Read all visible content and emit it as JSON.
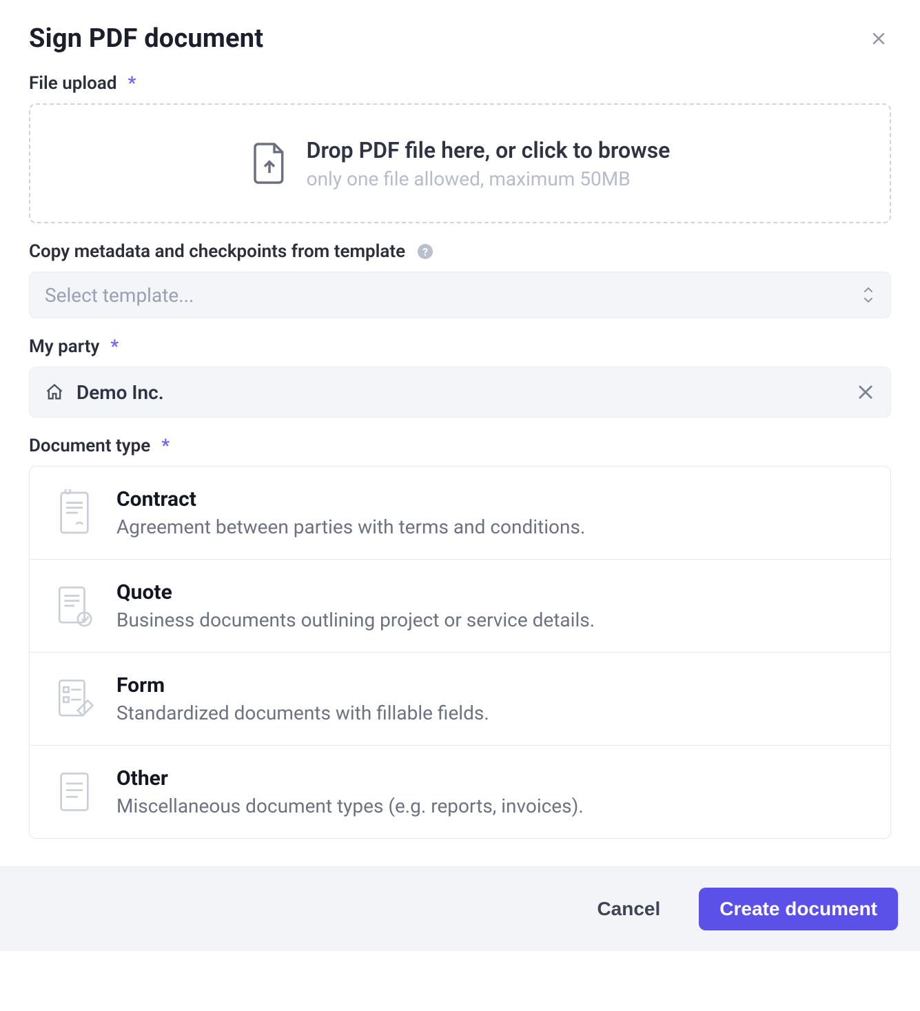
{
  "header": {
    "title": "Sign PDF document"
  },
  "sections": {
    "file_upload": {
      "label": "File upload",
      "dropzone": {
        "title": "Drop PDF file here, or click to browse",
        "subtitle": "only one file allowed, maximum 50MB"
      }
    },
    "template": {
      "label": "Copy metadata and checkpoints from template",
      "placeholder": "Select template..."
    },
    "my_party": {
      "label": "My party",
      "value": "Demo Inc."
    },
    "doc_type": {
      "label": "Document type",
      "options": [
        {
          "title": "Contract",
          "desc": "Agreement between parties with terms and conditions."
        },
        {
          "title": "Quote",
          "desc": "Business documents outlining project or service details."
        },
        {
          "title": "Form",
          "desc": "Standardized documents with fillable fields."
        },
        {
          "title": "Other",
          "desc": "Miscellaneous document types (e.g. reports, invoices)."
        }
      ]
    }
  },
  "footer": {
    "cancel": "Cancel",
    "submit": "Create document"
  },
  "required_marker": "*",
  "help_glyph": "?"
}
